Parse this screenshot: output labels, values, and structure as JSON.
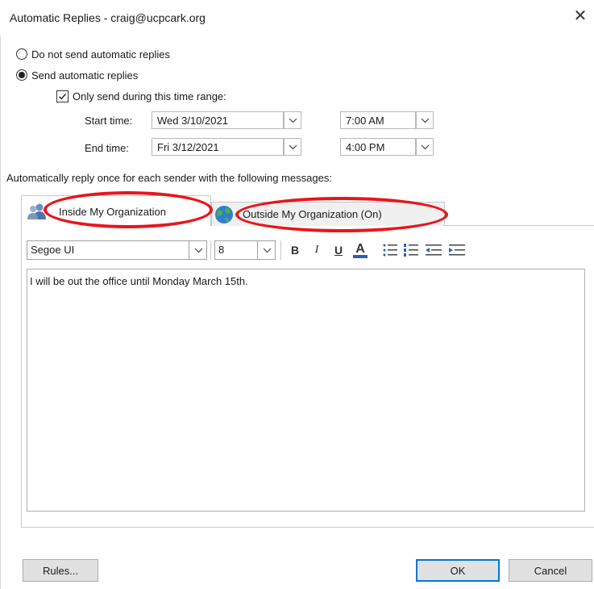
{
  "window": {
    "title": "Automatic Replies - craig@ucpcark.org",
    "close_label": "✕"
  },
  "options": {
    "do_not_send": {
      "label": "Do not send automatic replies",
      "checked": false
    },
    "send_auto": {
      "label": "Send automatic replies",
      "checked": true
    },
    "only_range": {
      "label": "Only send during this time range:",
      "checked": true
    }
  },
  "time_range": {
    "start_label": "Start time:",
    "start_date": "Wed 3/10/2021",
    "start_time": "7:00 AM",
    "end_label": "End time:",
    "end_date": "Fri 3/12/2021",
    "end_time": "4:00 PM"
  },
  "reply_prompt": "Automatically reply once for each sender with the following messages:",
  "tabs": {
    "inside": "Inside My Organization",
    "outside": "Outside My Organization (On)"
  },
  "toolbar": {
    "font": "Segoe UI",
    "size": "8",
    "bold": "B",
    "italic": "I",
    "underline": "U",
    "font_color": "A"
  },
  "message": "I will be out the office until Monday March 15th.",
  "buttons": {
    "rules": "Rules...",
    "ok": "OK",
    "cancel": "Cancel"
  },
  "colors": {
    "annotation": "#e8151c",
    "accent": "#0078d7"
  }
}
